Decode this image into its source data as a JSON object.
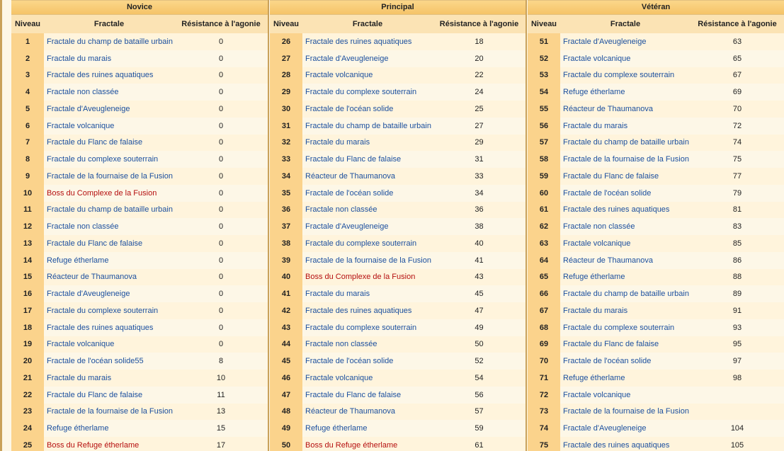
{
  "panels": [
    {
      "title": "Novice",
      "headers": {
        "level": "Niveau",
        "name": "Fractale",
        "res": "Résistance à l'agonie"
      },
      "rows": [
        {
          "level": "1",
          "name": "Fractale du champ de bataille urbain",
          "res": "0",
          "boss": false
        },
        {
          "level": "2",
          "name": "Fractale du marais",
          "res": "0",
          "boss": false
        },
        {
          "level": "3",
          "name": "Fractale des ruines aquatiques",
          "res": "0",
          "boss": false
        },
        {
          "level": "4",
          "name": "Fractale non classée",
          "res": "0",
          "boss": false
        },
        {
          "level": "5",
          "name": "Fractale d'Aveugleneige",
          "res": "0",
          "boss": false
        },
        {
          "level": "6",
          "name": "Fractale volcanique",
          "res": "0",
          "boss": false
        },
        {
          "level": "7",
          "name": "Fractale du Flanc de falaise",
          "res": "0",
          "boss": false
        },
        {
          "level": "8",
          "name": "Fractale du complexe souterrain",
          "res": "0",
          "boss": false
        },
        {
          "level": "9",
          "name": "Fractale de la fournaise de la Fusion",
          "res": "0",
          "boss": false
        },
        {
          "level": "10",
          "name": "Boss du Complexe de la Fusion",
          "res": "0",
          "boss": true
        },
        {
          "level": "11",
          "name": "Fractale du champ de bataille urbain",
          "res": "0",
          "boss": false
        },
        {
          "level": "12",
          "name": "Fractale non classée",
          "res": "0",
          "boss": false
        },
        {
          "level": "13",
          "name": "Fractale du Flanc de falaise",
          "res": "0",
          "boss": false
        },
        {
          "level": "14",
          "name": "Refuge étherlame",
          "res": "0",
          "boss": false
        },
        {
          "level": "15",
          "name": "Réacteur de Thaumanova",
          "res": "0",
          "boss": false
        },
        {
          "level": "16",
          "name": "Fractale d'Aveugleneige",
          "res": "0",
          "boss": false
        },
        {
          "level": "17",
          "name": "Fractale du complexe souterrain",
          "res": "0",
          "boss": false
        },
        {
          "level": "18",
          "name": "Fractale des ruines aquatiques",
          "res": "0",
          "boss": false
        },
        {
          "level": "19",
          "name": "Fractale volcanique",
          "res": "0",
          "boss": false
        },
        {
          "level": "20",
          "name": "Fractale de l'océan solide55",
          "res": "8",
          "boss": false
        },
        {
          "level": "21",
          "name": "Fractale du marais",
          "res": "10",
          "boss": false
        },
        {
          "level": "22",
          "name": "Fractale du Flanc de falaise",
          "res": "11",
          "boss": false
        },
        {
          "level": "23",
          "name": "Fractale de la fournaise de la Fusion",
          "res": "13",
          "boss": false
        },
        {
          "level": "24",
          "name": "Refuge étherlame",
          "res": "15",
          "boss": false
        },
        {
          "level": "25",
          "name": "Boss du Refuge étherlame",
          "res": "17",
          "boss": true
        }
      ]
    },
    {
      "title": "Principal",
      "headers": {
        "level": "Niveau",
        "name": "Fractale",
        "res": "Résistance à l'agonie"
      },
      "rows": [
        {
          "level": "26",
          "name": "Fractale des ruines aquatiques",
          "res": "18",
          "boss": false
        },
        {
          "level": "27",
          "name": "Fractale d'Aveugleneige",
          "res": "20",
          "boss": false
        },
        {
          "level": "28",
          "name": "Fractale volcanique",
          "res": "22",
          "boss": false
        },
        {
          "level": "29",
          "name": "Fractale du complexe souterrain",
          "res": "24",
          "boss": false
        },
        {
          "level": "30",
          "name": "Fractale de l'océan solide",
          "res": "25",
          "boss": false
        },
        {
          "level": "31",
          "name": "Fractale du champ de bataille urbain",
          "res": "27",
          "boss": false
        },
        {
          "level": "32",
          "name": "Fractale du marais",
          "res": "29",
          "boss": false
        },
        {
          "level": "33",
          "name": "Fractale du Flanc de falaise",
          "res": "31",
          "boss": false
        },
        {
          "level": "34",
          "name": "Réacteur de Thaumanova",
          "res": "33",
          "boss": false
        },
        {
          "level": "35",
          "name": "Fractale de l'océan solide",
          "res": "34",
          "boss": false
        },
        {
          "level": "36",
          "name": "Fractale non classée",
          "res": "36",
          "boss": false
        },
        {
          "level": "37",
          "name": "Fractale d'Aveugleneige",
          "res": "38",
          "boss": false
        },
        {
          "level": "38",
          "name": "Fractale du complexe souterrain",
          "res": "40",
          "boss": false
        },
        {
          "level": "39",
          "name": "Fractale de la fournaise de la Fusion",
          "res": "41",
          "boss": false
        },
        {
          "level": "40",
          "name": "Boss du Complexe de la Fusion",
          "res": "43",
          "boss": true
        },
        {
          "level": "41",
          "name": "Fractale du marais",
          "res": "45",
          "boss": false
        },
        {
          "level": "42",
          "name": "Fractale des ruines aquatiques",
          "res": "47",
          "boss": false
        },
        {
          "level": "43",
          "name": "Fractale du complexe souterrain",
          "res": "49",
          "boss": false
        },
        {
          "level": "44",
          "name": "Fractale non classée",
          "res": "50",
          "boss": false
        },
        {
          "level": "45",
          "name": "Fractale de l'océan solide",
          "res": "52",
          "boss": false
        },
        {
          "level": "46",
          "name": "Fractale volcanique",
          "res": "54",
          "boss": false
        },
        {
          "level": "47",
          "name": "Fractale du Flanc de falaise",
          "res": "56",
          "boss": false
        },
        {
          "level": "48",
          "name": "Réacteur de Thaumanova",
          "res": "57",
          "boss": false
        },
        {
          "level": "49",
          "name": "Refuge étherlame",
          "res": "59",
          "boss": false
        },
        {
          "level": "50",
          "name": "Boss du Refuge étherlame",
          "res": "61",
          "boss": true
        }
      ]
    },
    {
      "title": "Vétéran",
      "headers": {
        "level": "Niveau",
        "name": "Fractale",
        "res": "Résistance à l'agonie"
      },
      "rows": [
        {
          "level": "51",
          "name": "Fractale d'Aveugleneige",
          "res": "63",
          "boss": false
        },
        {
          "level": "52",
          "name": "Fractale volcanique",
          "res": "65",
          "boss": false
        },
        {
          "level": "53",
          "name": "Fractale du complexe souterrain",
          "res": "67",
          "boss": false
        },
        {
          "level": "54",
          "name": "Refuge étherlame",
          "res": "69",
          "boss": false
        },
        {
          "level": "55",
          "name": "Réacteur de Thaumanova",
          "res": "70",
          "boss": false
        },
        {
          "level": "56",
          "name": "Fractale du marais",
          "res": "72",
          "boss": false
        },
        {
          "level": "57",
          "name": "Fractale du champ de bataille urbain",
          "res": "74",
          "boss": false
        },
        {
          "level": "58",
          "name": "Fractale de la fournaise de la Fusion",
          "res": "75",
          "boss": false
        },
        {
          "level": "59",
          "name": "Fractale du Flanc de falaise",
          "res": "77",
          "boss": false
        },
        {
          "level": "60",
          "name": "Fractale de l'océan solide",
          "res": "79",
          "boss": false
        },
        {
          "level": "61",
          "name": "Fractale des ruines aquatiques",
          "res": "81",
          "boss": false
        },
        {
          "level": "62",
          "name": "Fractale non classée",
          "res": "83",
          "boss": false
        },
        {
          "level": "63",
          "name": "Fractale volcanique",
          "res": "85",
          "boss": false
        },
        {
          "level": "64",
          "name": "Réacteur de Thaumanova",
          "res": "86",
          "boss": false
        },
        {
          "level": "65",
          "name": "Refuge étherlame",
          "res": "88",
          "boss": false
        },
        {
          "level": "66",
          "name": "Fractale du champ de bataille urbain",
          "res": "89",
          "boss": false
        },
        {
          "level": "67",
          "name": "Fractale du marais",
          "res": "91",
          "boss": false
        },
        {
          "level": "68",
          "name": "Fractale du complexe souterrain",
          "res": "93",
          "boss": false
        },
        {
          "level": "69",
          "name": "Fractale du Flanc de falaise",
          "res": "95",
          "boss": false
        },
        {
          "level": "70",
          "name": "Fractale de l'océan solide",
          "res": "97",
          "boss": false
        },
        {
          "level": "71",
          "name": "Refuge étherlame",
          "res": "98",
          "boss": false
        },
        {
          "level": "72",
          "name": "Fractale volcanique",
          "res": "",
          "boss": false
        },
        {
          "level": "73",
          "name": "Fractale de la fournaise de la Fusion",
          "res": "",
          "boss": false
        },
        {
          "level": "74",
          "name": "Fractale d'Aveugleneige",
          "res": "104",
          "boss": false
        },
        {
          "level": "75",
          "name": "Fractale des ruines aquatiques",
          "res": "105",
          "boss": false
        }
      ]
    }
  ]
}
